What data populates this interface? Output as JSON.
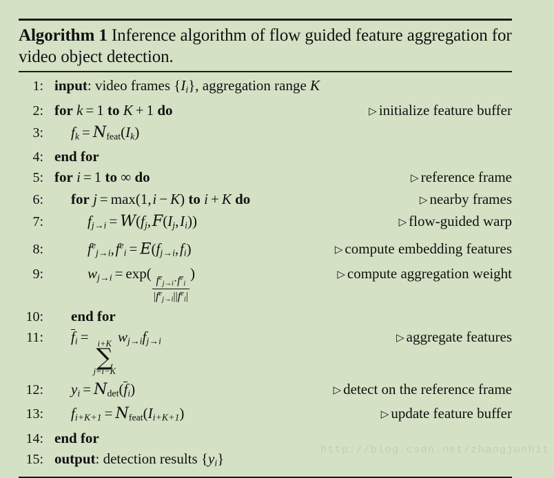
{
  "document": {
    "background_color": "#d5e1c5",
    "rule_color": "#1a1a1a"
  },
  "algorithm": {
    "name": "Algorithm 1",
    "caption": "Inference algorithm of flow guided feature aggregation for video object detection.",
    "lines": [
      {
        "number": "1",
        "indent": 0,
        "code": "input: video frames {I_i}, aggregation range K",
        "comment": ""
      },
      {
        "number": "2",
        "indent": 0,
        "code": "for k = 1 to K + 1 do",
        "comment": "initialize feature buffer"
      },
      {
        "number": "3",
        "indent": 1,
        "code": "f_k = N_feat(I_k)",
        "comment": ""
      },
      {
        "number": "4",
        "indent": 0,
        "code": "end for",
        "comment": ""
      },
      {
        "number": "5",
        "indent": 0,
        "code": "for i = 1 to ∞ do",
        "comment": "reference frame"
      },
      {
        "number": "6",
        "indent": 1,
        "code": "for j = max(1, i − K) to i + K do",
        "comment": "nearby frames"
      },
      {
        "number": "7",
        "indent": 2,
        "code": "f_{j→i} = W(f_j, F(I_j, I_i))",
        "comment": "flow-guided warp"
      },
      {
        "number": "8",
        "indent": 2,
        "code": "f^e_{j→i}, f^e_i = E(f_{j→i}, f_i)",
        "comment": "compute embedding features"
      },
      {
        "number": "9",
        "indent": 2,
        "code": "w_{j→i} = exp( (f^e_{j→i} · f^e_i) / (|f^e_{j→i}||f^e_i|) )",
        "comment": "compute aggregation weight"
      },
      {
        "number": "10",
        "indent": 1,
        "code": "end for",
        "comment": ""
      },
      {
        "number": "11",
        "indent": 1,
        "code": "f̄_i = Σ_{j=i−K}^{i+K} w_{j→i} f_{j→i}",
        "comment": "aggregate features"
      },
      {
        "number": "12",
        "indent": 1,
        "code": "y_i = N_det(f̄_i)",
        "comment": "detect on the reference frame"
      },
      {
        "number": "13",
        "indent": 1,
        "code": "f_{i+K+1} = N_feat(I_{i+K+1})",
        "comment": "update feature buffer"
      },
      {
        "number": "14",
        "indent": 0,
        "code": "end for",
        "comment": ""
      },
      {
        "number": "15",
        "indent": 0,
        "code": "output: detection results {y_i}",
        "comment": ""
      }
    ],
    "comments": {
      "line2": "initialize feature buffer",
      "line5": "reference frame",
      "line6": "nearby frames",
      "line7": "flow-guided warp",
      "line8": "compute embedding features",
      "line9": "compute aggregation weight",
      "line11": "aggregate features",
      "line12": "detect on the reference frame",
      "line13": "update feature buffer"
    },
    "keywords": {
      "input": "input",
      "output": "output",
      "for": "for",
      "to": "to",
      "do": "do",
      "end_for": "end for"
    },
    "line_numbers": [
      "1",
      "2",
      "3",
      "4",
      "5",
      "6",
      "7",
      "8",
      "9",
      "10",
      "11",
      "12",
      "13",
      "14",
      "15"
    ]
  },
  "watermark": {
    "text": "http://blog.csdn.net/zhangjunhit"
  }
}
